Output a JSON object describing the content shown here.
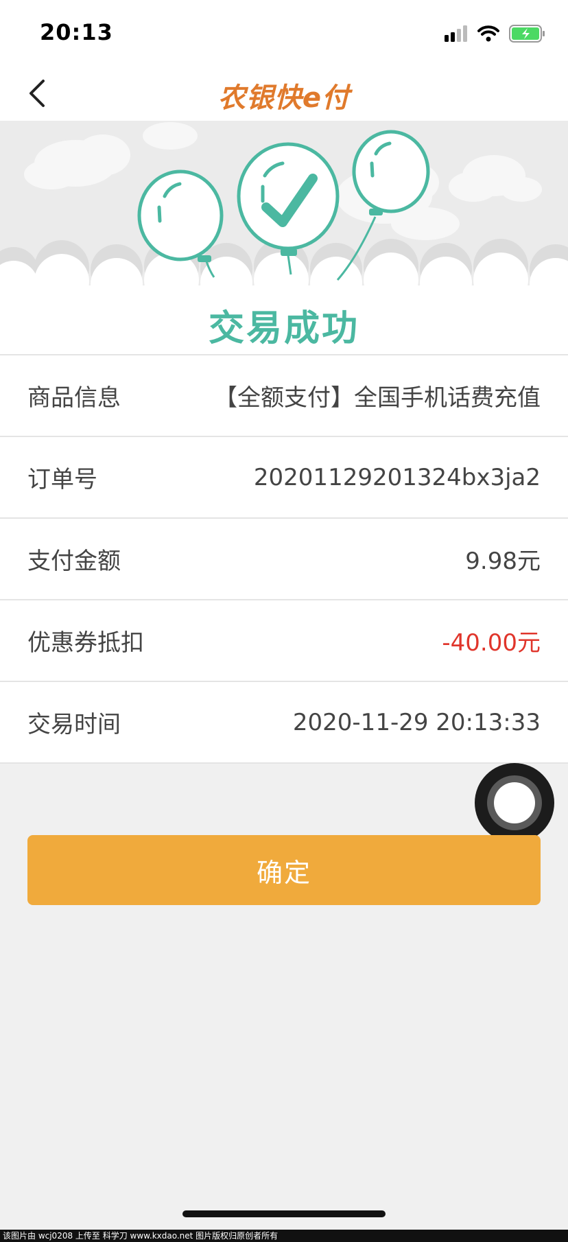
{
  "status_bar": {
    "time": "20:13",
    "signal_icon": "signal-icon",
    "wifi_icon": "wifi-icon",
    "battery_icon": "battery-charging-icon",
    "battery_color": "#4cd964"
  },
  "nav": {
    "back_icon": "chevron-left-icon",
    "brand": "农银快e付",
    "brand_color": "#e07a2c"
  },
  "hero": {
    "illustration": "balloons-checkmark-illustration",
    "title": "交易成功",
    "accent": "#4bb8a1"
  },
  "details": [
    {
      "label": "商品信息",
      "value": "【全额支付】全国手机话费充值"
    },
    {
      "label": "订单号",
      "value": "20201129201324bx3ja2"
    },
    {
      "label": "支付金额",
      "value": "9.98元"
    },
    {
      "label": "优惠券抵扣",
      "value": "-40.00元",
      "color": "#e0352b"
    },
    {
      "label": "交易时间",
      "value": "2020-11-29 20:13:33"
    }
  ],
  "confirm_button": {
    "label": "确定",
    "color": "#f0aa3c"
  },
  "watermark": "该图片由 wcj0208 上传至 科学刀 www.kxdao.net 图片版权归原创者所有"
}
